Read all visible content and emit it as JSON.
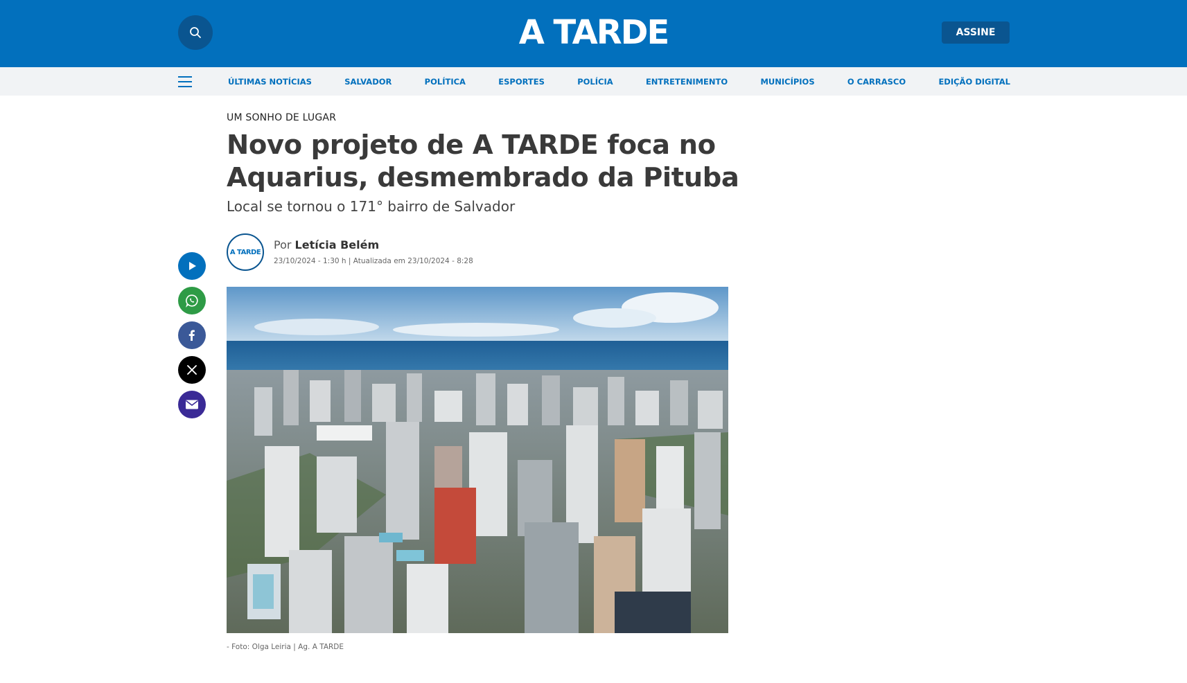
{
  "header": {
    "logo_text": "A TARDE",
    "subscribe_label": "ASSINE",
    "brand_color": "#0270bd"
  },
  "nav": {
    "items": [
      {
        "label": "ÚLTIMAS NOTÍCIAS"
      },
      {
        "label": "SALVADOR"
      },
      {
        "label": "POLÍTICA"
      },
      {
        "label": "ESPORTES"
      },
      {
        "label": "POLÍCIA"
      },
      {
        "label": "ENTRETENIMENTO"
      },
      {
        "label": "MUNICÍPIOS"
      },
      {
        "label": "O CARRASCO"
      },
      {
        "label": "EDIÇÃO DIGITAL"
      }
    ]
  },
  "article": {
    "kicker": "UM SONHO DE LUGAR",
    "title": "Novo projeto de A TARDE foca no Aquarius, desmembrado da Pituba",
    "subtitle": "Local se tornou o 171° bairro de Salvador",
    "author": {
      "avatar_text": "A TARDE",
      "prefix": "Por",
      "name": "Letícia Belém",
      "dateline": "23/10/2024 - 1:30 h | Atualizada em 23/10/2024 - 8:28"
    },
    "image_caption": "- Foto: Olga Leiria | Ag. A TARDE"
  },
  "share": {
    "buttons": [
      {
        "icon": "play-icon",
        "color": "#0270bd"
      },
      {
        "icon": "whatsapp-icon",
        "color": "#2e9b46"
      },
      {
        "icon": "facebook-icon",
        "color": "#3b5998"
      },
      {
        "icon": "x-icon",
        "color": "#000000"
      },
      {
        "icon": "mail-icon",
        "color": "#3a2a96"
      }
    ]
  }
}
